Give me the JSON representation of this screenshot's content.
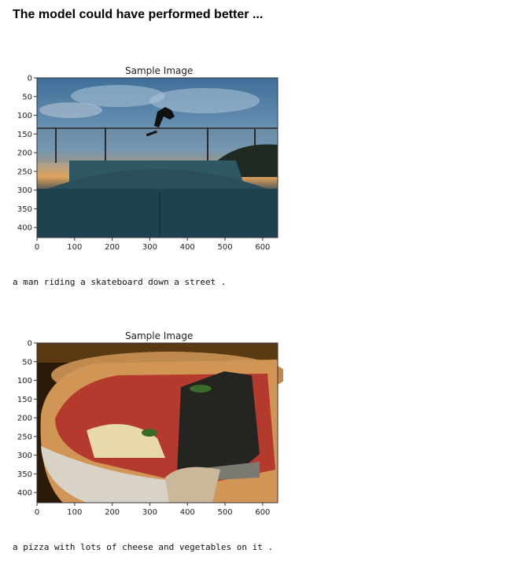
{
  "heading": "The model could have performed better ...",
  "samples": [
    {
      "title": "Sample Image",
      "caption": "a man riding a skateboard down a street .",
      "image_icon": "skatepark-photo",
      "x_ticks": [
        "0",
        "100",
        "200",
        "300",
        "400",
        "500",
        "600"
      ],
      "y_ticks": [
        "0",
        "50",
        "100",
        "150",
        "200",
        "250",
        "300",
        "350",
        "400"
      ]
    },
    {
      "title": "Sample Image",
      "caption": "a pizza with lots of cheese and vegetables on it .",
      "image_icon": "pizza-photo",
      "x_ticks": [
        "0",
        "100",
        "200",
        "300",
        "400",
        "500",
        "600"
      ],
      "y_ticks": [
        "0",
        "50",
        "100",
        "150",
        "200",
        "250",
        "300",
        "350",
        "400"
      ]
    }
  ]
}
